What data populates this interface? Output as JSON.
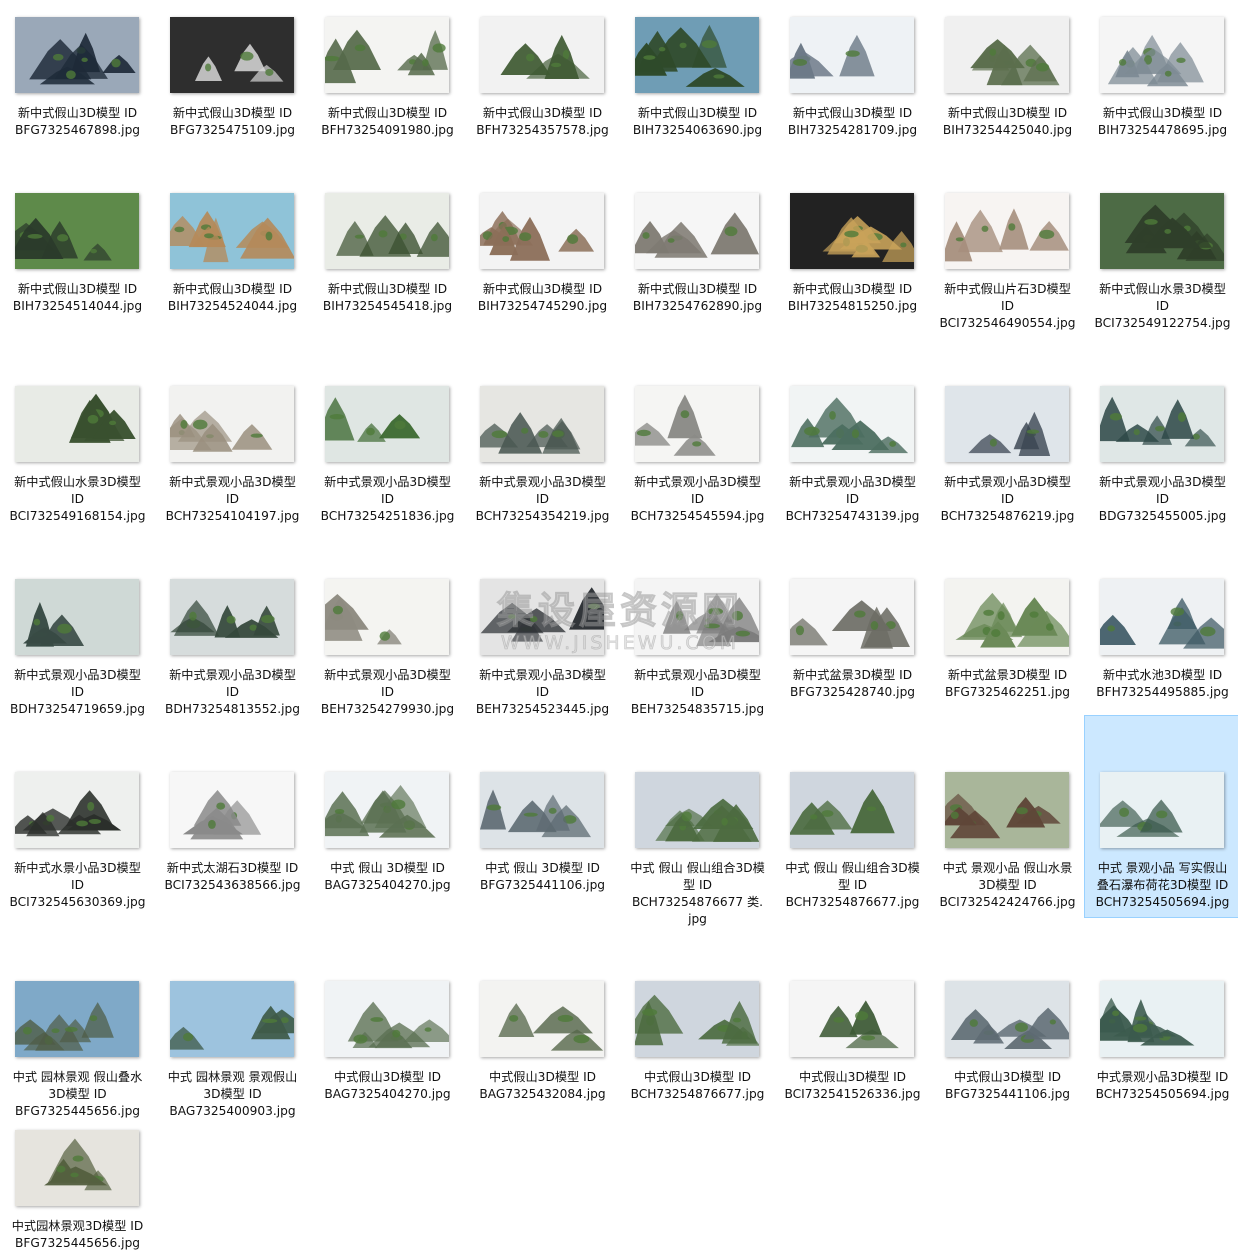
{
  "items": [
    {
      "lines": [
        "新中式假山3D模型 ID",
        "BFG7325467898.jpg"
      ],
      "bg": "#9aa8b8",
      "fg": "#1e2a38",
      "selected": false
    },
    {
      "lines": [
        "新中式假山3D模型 ID",
        "BFG7325475109.jpg"
      ],
      "bg": "#2e2e2e",
      "fg": "#d9d9d9",
      "selected": false
    },
    {
      "lines": [
        "新中式假山3D模型 ID",
        "BFH73254091980.jpg"
      ],
      "bg": "#f4f4f2",
      "fg": "#55694a",
      "selected": false
    },
    {
      "lines": [
        "新中式假山3D模型 ID",
        "BFH73254357578.jpg"
      ],
      "bg": "#f2f2f2",
      "fg": "#3f5a33",
      "selected": false
    },
    {
      "lines": [
        "新中式假山3D模型 ID",
        "BIH73254063690.jpg"
      ],
      "bg": "#6f9db5",
      "fg": "#2f4a2a",
      "selected": false
    },
    {
      "lines": [
        "新中式假山3D模型 ID",
        "BIH73254281709.jpg"
      ],
      "bg": "#eef2f5",
      "fg": "#6d7a88",
      "selected": false
    },
    {
      "lines": [
        "新中式假山3D模型 ID",
        "BIH73254425040.jpg"
      ],
      "bg": "#f0f0f0",
      "fg": "#5b6e4d",
      "selected": false
    },
    {
      "lines": [
        "新中式假山3D模型 ID",
        "BIH73254478695.jpg"
      ],
      "bg": "#f5f5f5",
      "fg": "#7d8a94",
      "selected": false
    },
    {
      "lines": [
        "新中式假山3D模型 ID",
        "BIH73254514044.jpg"
      ],
      "bg": "#5e8a4a",
      "fg": "#2b3a2b",
      "selected": false
    },
    {
      "lines": [
        "新中式假山3D模型 ID",
        "BIH73254524044.jpg"
      ],
      "bg": "#8fc3d8",
      "fg": "#b58a5a",
      "selected": false
    },
    {
      "lines": [
        "新中式假山3D模型 ID",
        "BIH73254545418.jpg"
      ],
      "bg": "#e9ece6",
      "fg": "#3c5232",
      "selected": false
    },
    {
      "lines": [
        "新中式假山3D模型 ID",
        "BIH73254745290.jpg"
      ],
      "bg": "#f3f3f3",
      "fg": "#8b6e58",
      "selected": false
    },
    {
      "lines": [
        "新中式假山3D模型 ID",
        "BIH73254762890.jpg"
      ],
      "bg": "#f6f6f6",
      "fg": "#7e7a72",
      "selected": false
    },
    {
      "lines": [
        "新中式假山3D模型 ID",
        "BIH73254815250.jpg"
      ],
      "bg": "#222222",
      "fg": "#c9a35a",
      "selected": false
    },
    {
      "lines": [
        "新中式假山片石3D模型",
        "ID",
        "BCI732546490554.jpg"
      ],
      "bg": "#f7f4f2",
      "fg": "#a58d7c",
      "selected": false
    },
    {
      "lines": [
        "新中式假山水景3D模型",
        "ID",
        "BCI732549122754.jpg"
      ],
      "bg": "#4d6b45",
      "fg": "#2f3f2a",
      "selected": false
    },
    {
      "lines": [
        "新中式假山水景3D模型",
        "ID",
        "BCI732549168154.jpg"
      ],
      "bg": "#e8ebe6",
      "fg": "#39502f",
      "selected": false
    },
    {
      "lines": [
        "新中式景观小品3D模型",
        "ID",
        "BCH73254104197.jpg"
      ],
      "bg": "#f2f2f0",
      "fg": "#9a8f7e",
      "selected": false
    },
    {
      "lines": [
        "新中式景观小品3D模型",
        "ID",
        "BCH73254251836.jpg"
      ],
      "bg": "#dfe6e3",
      "fg": "#3f6b34",
      "selected": false
    },
    {
      "lines": [
        "新中式景观小品3D模型",
        "ID",
        "BCH73254354219.jpg"
      ],
      "bg": "#e6e6e2",
      "fg": "#4a5852",
      "selected": false
    },
    {
      "lines": [
        "新中式景观小品3D模型",
        "ID",
        "BCH73254545594.jpg"
      ],
      "bg": "#f5f5f3",
      "fg": "#8a8a86",
      "selected": false
    },
    {
      "lines": [
        "新中式景观小品3D模型",
        "ID",
        "BCH73254743139.jpg"
      ],
      "bg": "#f1f4f4",
      "fg": "#4c6e60",
      "selected": false
    },
    {
      "lines": [
        "新中式景观小品3D模型",
        "ID",
        "BCH73254876219.jpg"
      ],
      "bg": "#dfe5ea",
      "fg": "#3b4652",
      "selected": false
    },
    {
      "lines": [
        "新中式景观小品3D模型",
        "ID",
        "BDG7325455005.jpg"
      ],
      "bg": "#dfe7e6",
      "fg": "#2f4a48",
      "selected": false
    },
    {
      "lines": [
        "新中式景观小品3D模型",
        "ID",
        "BDH73254719659.jpg"
      ],
      "bg": "#cfd9d6",
      "fg": "#384a44",
      "selected": false
    },
    {
      "lines": [
        "新中式景观小品3D模型",
        "ID",
        "BDH73254813552.jpg"
      ],
      "bg": "#d6dcdc",
      "fg": "#35483b",
      "selected": false
    },
    {
      "lines": [
        "新中式景观小品3D模型",
        "ID",
        "BEH73254279930.jpg"
      ],
      "bg": "#f4f4f1",
      "fg": "#8d8a80",
      "selected": false
    },
    {
      "lines": [
        "新中式景观小品3D模型",
        "ID",
        "BEH73254523445.jpg"
      ],
      "bg": "#e4e4e4",
      "fg": "#2f3337",
      "selected": false
    },
    {
      "lines": [
        "新中式景观小品3D模型",
        "ID",
        "BEH73254835715.jpg"
      ],
      "bg": "#f4f4f4",
      "fg": "#7c7c7c",
      "selected": false
    },
    {
      "lines": [
        "新中式盆景3D模型 ID",
        "BFG7325428740.jpg"
      ],
      "bg": "#f5f5f5",
      "fg": "#6c6c64",
      "selected": false
    },
    {
      "lines": [
        "新中式盆景3D模型 ID",
        "BFG7325462251.jpg"
      ],
      "bg": "#f3f3f0",
      "fg": "#6b8a58",
      "selected": false
    },
    {
      "lines": [
        "新中式水池3D模型 ID",
        "BFH73254495885.jpg"
      ],
      "bg": "#eef1f3",
      "fg": "#3f5b66",
      "selected": false
    },
    {
      "lines": [
        "新中式水景小品3D模型",
        "ID",
        "BCI732545630369.jpg"
      ],
      "bg": "#eef0ee",
      "fg": "#2b2f2b",
      "selected": false
    },
    {
      "lines": [
        "新中式太湖石3D模型 ID",
        "BCI732543638566.jpg"
      ],
      "bg": "#f7f7f7",
      "fg": "#8a8a8a",
      "selected": false
    },
    {
      "lines": [
        "中式 假山 3D模型 ID",
        "BAG7325404270.jpg"
      ],
      "bg": "#f0f3f5",
      "fg": "#5b7052",
      "selected": false
    },
    {
      "lines": [
        "中式 假山 3D模型 ID",
        "BFG7325441106.jpg"
      ],
      "bg": "#dde3e7",
      "fg": "#5d6a72",
      "selected": false
    },
    {
      "lines": [
        "中式 假山 假山组合3D模",
        "型 ID",
        "BCH73254876677 类.",
        "jpg"
      ],
      "bg": "#cfd6de",
      "fg": "#4c6b40",
      "selected": false
    },
    {
      "lines": [
        "中式 假山 假山组合3D模",
        "型 ID",
        "BCH73254876677.jpg"
      ],
      "bg": "#cfd6de",
      "fg": "#4c6b40",
      "selected": false
    },
    {
      "lines": [
        "中式 景观小品 假山水景",
        "3D模型 ID",
        "BCI732542424766.jpg"
      ],
      "bg": "#a9b69a",
      "fg": "#5f4638",
      "selected": false
    },
    {
      "lines": [
        "中式 景观小品 写实假山",
        "叠石瀑布荷花3D模型 ID",
        "BCH73254505694.jpg"
      ],
      "bg": "#e9f1f3",
      "fg": "#3b5a4d",
      "selected": true
    },
    {
      "lines": [
        "中式 园林景观 假山叠水",
        "3D模型 ID",
        "BFG7325445656.jpg"
      ],
      "bg": "#7fa9c8",
      "fg": "#4e5b44",
      "selected": false
    },
    {
      "lines": [
        "中式 园林景观 景观假山",
        "3D模型 ID",
        "BAG7325400903.jpg"
      ],
      "bg": "#9dc3de",
      "fg": "#3e5a48",
      "selected": false
    },
    {
      "lines": [
        "中式假山3D模型 ID",
        "BAG7325404270.jpg"
      ],
      "bg": "#f0f3f5",
      "fg": "#5b7052",
      "selected": false
    },
    {
      "lines": [
        "中式假山3D模型 ID",
        "BAG7325432084.jpg"
      ],
      "bg": "#f3f3f1",
      "fg": "#55674a",
      "selected": false
    },
    {
      "lines": [
        "中式假山3D模型 ID",
        "BCH73254876677.jpg"
      ],
      "bg": "#cfd6de",
      "fg": "#4c6b40",
      "selected": false
    },
    {
      "lines": [
        "中式假山3D模型 ID",
        "BCI732541526336.jpg"
      ],
      "bg": "#f5f5f5",
      "fg": "#3e5a36",
      "selected": false
    },
    {
      "lines": [
        "中式假山3D模型 ID",
        "BFG7325441106.jpg"
      ],
      "bg": "#dde3e7",
      "fg": "#5d6a72",
      "selected": false
    },
    {
      "lines": [
        "中式景观小品3D模型 ID",
        "BCH73254505694.jpg"
      ],
      "bg": "#e9f1f3",
      "fg": "#3b5a4d",
      "selected": false
    },
    {
      "lines": [
        "中式园林景观3D模型 ID",
        "BFG7325445656.jpg"
      ],
      "bg": "#e6e4de",
      "fg": "#54603f",
      "selected": false
    }
  ],
  "watermark": {
    "title": "集设屋资源网",
    "url": "WWW.JISHEWU.COM"
  }
}
